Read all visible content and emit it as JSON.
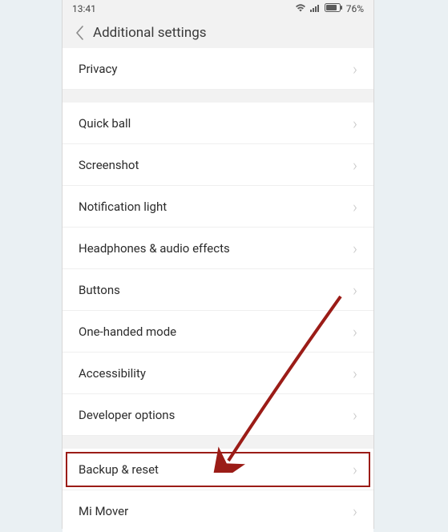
{
  "status": {
    "time": "13:41",
    "battery_pct": "76%"
  },
  "header": {
    "title": "Additional  settings"
  },
  "section0": {
    "privacy": "Privacy"
  },
  "section1": {
    "quick_ball": "Quick ball",
    "screenshot": "Screenshot",
    "notification_light": "Notification light",
    "headphones": "Headphones & audio effects",
    "buttons": "Buttons",
    "one_handed": "One-handed mode",
    "accessibility": "Accessibility",
    "developer": "Developer options"
  },
  "section2": {
    "backup_reset": "Backup & reset",
    "mi_mover": "Mi Mover"
  },
  "annotation": {
    "highlight_target": "backup-reset-item",
    "arrow_color": "#9b1c17"
  }
}
